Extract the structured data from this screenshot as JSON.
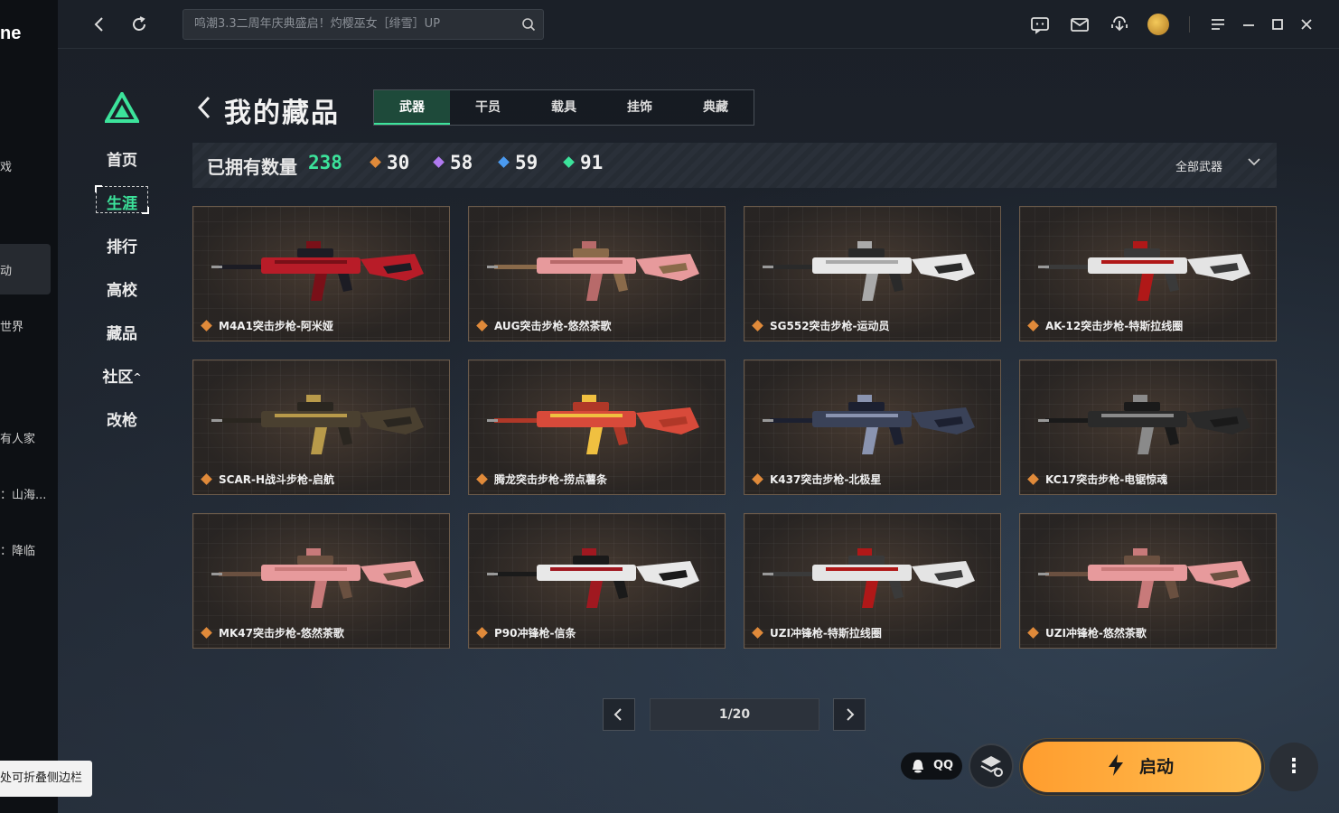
{
  "left_strip": {
    "brand": "ne",
    "items": [
      "戏",
      "动",
      "世界",
      "有人家",
      "：山海...",
      "：降临"
    ],
    "tooltip": "处可折叠侧边栏"
  },
  "topbar": {
    "search_placeholder": "鸣潮3.3二周年庆典盛启！灼樱巫女［绯雪］UP"
  },
  "nav": {
    "items": [
      "首页",
      "生涯",
      "排行",
      "高校",
      "藏品",
      "社区",
      "改枪"
    ],
    "community_arrow": "^"
  },
  "page": {
    "title": "我的藏品",
    "tabs": [
      "武器",
      "干员",
      "载具",
      "挂饰",
      "典藏"
    ],
    "active_tab": 0
  },
  "stats": {
    "label": "已拥有数量",
    "total": "238",
    "by_quality": [
      {
        "value": "30",
        "color": "#e08a3a"
      },
      {
        "value": "58",
        "color": "#b07af0"
      },
      {
        "value": "59",
        "color": "#4a9af0"
      },
      {
        "value": "91",
        "color": "#3ce39b"
      }
    ],
    "filter": "全部武器"
  },
  "weapons": [
    {
      "name": "M4A1突击步枪-阿米娅",
      "colors": [
        "#b81c28",
        "#7a1018",
        "#1c1c24"
      ]
    },
    {
      "name": "AUG突击步枪-悠然茶歌",
      "colors": [
        "#e79a9c",
        "#b86a6a",
        "#8a6a4a"
      ]
    },
    {
      "name": "SG552突击步枪-运动员",
      "colors": [
        "#e8e8e8",
        "#aaaaaa",
        "#2a2a2a"
      ]
    },
    {
      "name": "AK-12突击步枪-特斯拉线圈",
      "colors": [
        "#e4e4e4",
        "#b01818",
        "#3a3a3a"
      ]
    },
    {
      "name": "SCAR-H战斗步枪-启航",
      "colors": [
        "#4a4030",
        "#b89a4a",
        "#2a2620"
      ]
    },
    {
      "name": "腾龙突击步枪-捞点薯条",
      "colors": [
        "#d84a3a",
        "#f0c040",
        "#b03828"
      ]
    },
    {
      "name": "K437突击步枪-北极星",
      "colors": [
        "#3a4258",
        "#8a94b0",
        "#1c2030"
      ]
    },
    {
      "name": "KC17突击步枪-电锯惊魂",
      "colors": [
        "#2a2a2a",
        "#8a8a8a",
        "#1a1a1a"
      ]
    },
    {
      "name": "MK47突击步枪-悠然茶歌",
      "colors": [
        "#e79a9c",
        "#c87a7a",
        "#6a5040"
      ]
    },
    {
      "name": "P90冲锋枪-信条",
      "colors": [
        "#e8e8e8",
        "#a01820",
        "#1a1a1a"
      ]
    },
    {
      "name": "UZI冲锋枪-特斯拉线圈",
      "colors": [
        "#e4e4e4",
        "#b01818",
        "#3a3a3a"
      ]
    },
    {
      "name": "UZI冲锋枪-悠然茶歌",
      "colors": [
        "#e79a9c",
        "#c87a7a",
        "#6a5040"
      ]
    }
  ],
  "pager": {
    "text": "1/20",
    "prev": "‹",
    "next": "›"
  },
  "bottom": {
    "qq_label": "QQ",
    "launch_label": "启动",
    "more": "⋮"
  }
}
